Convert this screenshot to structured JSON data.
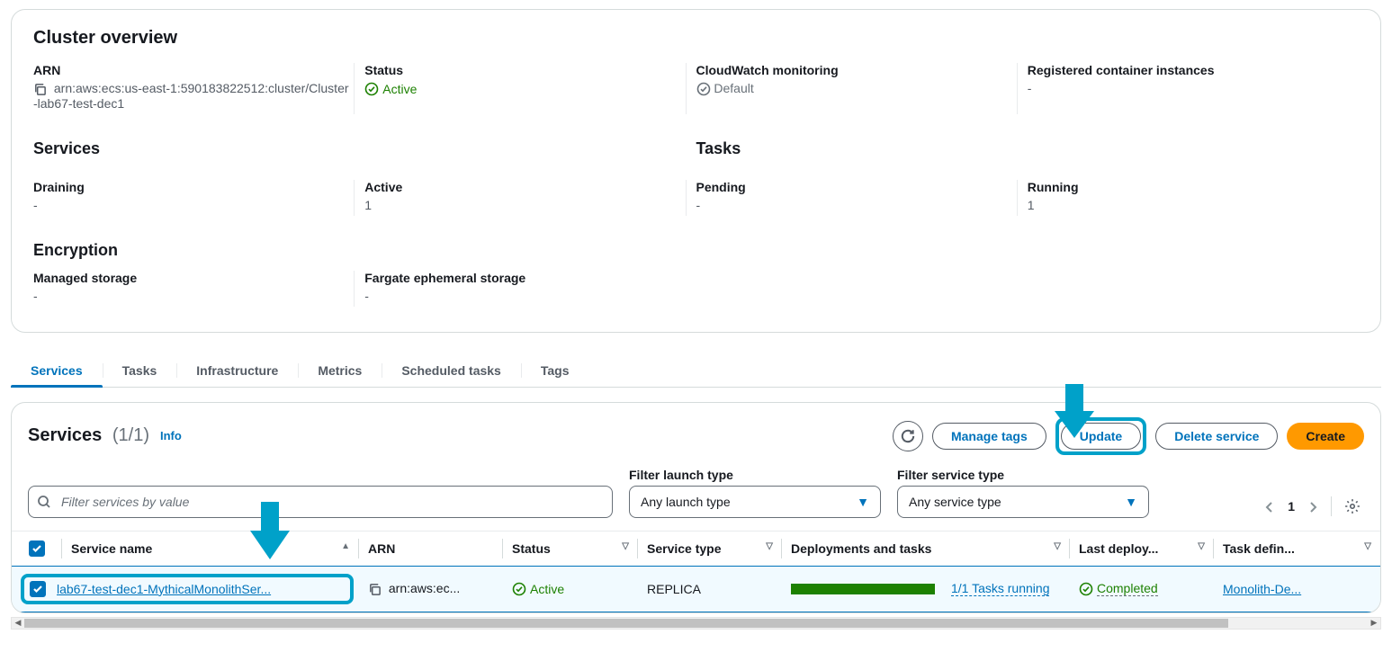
{
  "overview": {
    "title": "Cluster overview",
    "arn_label": "ARN",
    "arn_value": "arn:aws:ecs:us-east-1:590183822512:cluster/Cluster-lab67-test-dec1",
    "status_label": "Status",
    "status_value": "Active",
    "cw_label": "CloudWatch monitoring",
    "cw_value": "Default",
    "reg_label": "Registered container instances",
    "reg_value": "-",
    "services_heading": "Services",
    "tasks_heading": "Tasks",
    "draining_label": "Draining",
    "draining_value": "-",
    "active_label": "Active",
    "active_value": "1",
    "pending_label": "Pending",
    "pending_value": "-",
    "running_label": "Running",
    "running_value": "1",
    "encryption_heading": "Encryption",
    "managed_label": "Managed storage",
    "managed_value": "-",
    "fargate_label": "Fargate ephemeral storage",
    "fargate_value": "-"
  },
  "tabs": {
    "items": [
      {
        "label": "Services",
        "active": true
      },
      {
        "label": "Tasks"
      },
      {
        "label": "Infrastructure"
      },
      {
        "label": "Metrics"
      },
      {
        "label": "Scheduled tasks"
      },
      {
        "label": "Tags"
      }
    ]
  },
  "services": {
    "title": "Services",
    "count": "(1/1)",
    "info": "Info",
    "buttons": {
      "manage": "Manage tags",
      "update": "Update",
      "delete": "Delete service",
      "create": "Create"
    },
    "filters": {
      "search_placeholder": "Filter services by value",
      "launch_label": "Filter launch type",
      "launch_value": "Any launch type",
      "svc_label": "Filter service type",
      "svc_value": "Any service type"
    },
    "pager": {
      "current": "1"
    },
    "columns": {
      "name": "Service name",
      "arn": "ARN",
      "status": "Status",
      "type": "Service type",
      "deploy": "Deployments and tasks",
      "last": "Last deploy...",
      "taskdef": "Task defin..."
    },
    "row": {
      "name": "lab67-test-dec1-MythicalMonolithSer...",
      "arn": "arn:aws:ec...",
      "status": "Active",
      "type": "REPLICA",
      "tasks": "1/1 Tasks running",
      "last": "Completed",
      "taskdef": "Monolith-De..."
    }
  }
}
